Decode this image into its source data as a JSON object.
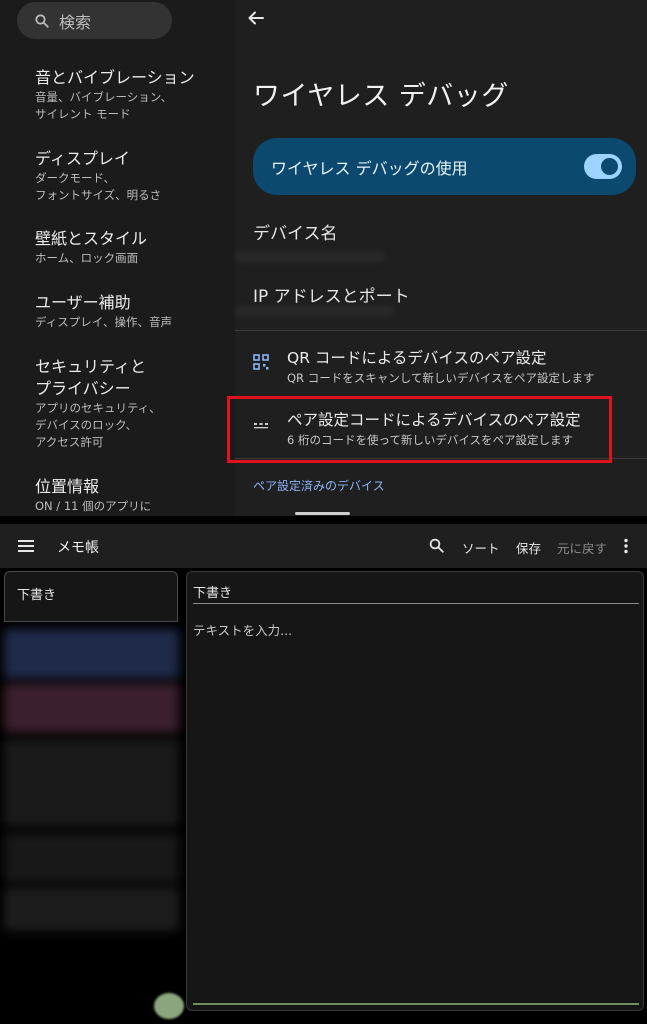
{
  "settings": {
    "search": {
      "placeholder": "検索"
    },
    "nav": [
      {
        "title": "音とバイブレーション",
        "sub": [
          "音量、バイブレーション、",
          "サイレント モード"
        ]
      },
      {
        "title": "ディスプレイ",
        "sub": [
          "ダークモード、",
          "フォントサイズ、明るさ"
        ]
      },
      {
        "title": "壁紙とスタイル",
        "sub": [
          "ホーム、ロック画面"
        ]
      },
      {
        "title": "ユーザー補助",
        "sub": [
          "ディスプレイ、操作、音声"
        ]
      },
      {
        "title": [
          "セキュリティと",
          "プライバシー"
        ],
        "sub": [
          "アプリのセキュリティ、",
          "デバイスのロック、",
          "アクセス許可"
        ]
      },
      {
        "title": "位置情報",
        "sub": [
          "ON / 11 個のアプリに"
        ]
      }
    ],
    "detail": {
      "title": "ワイヤレス デバッグ",
      "use_toggle": {
        "label": "ワイヤレス デバッグの使用",
        "enabled": true
      },
      "device_name_label": "デバイス名",
      "ip_label": "IP アドレスとポート",
      "pair_qr": {
        "title": "QR コードによるデバイスのペア設定",
        "sub": "QR コードをスキャンして新しいデバイスをペア設定します"
      },
      "pair_code": {
        "title": "ペア設定コードによるデバイスのペア設定",
        "sub": "6 桁のコードを使って新しいデバイスをペア設定します"
      },
      "paired_header": "ペア設定済みのデバイス"
    },
    "colors": {
      "accent": "#0b4a6e",
      "toggle_on": "#9dd3ff",
      "highlight_border": "#e0121c",
      "link": "#8ab4f8"
    }
  },
  "memo_app": {
    "title": "メモ帳",
    "toolbar": {
      "sort": "ソート",
      "save": "保存",
      "undo": "元に戻す"
    },
    "list": {
      "active_tab": "下書き"
    },
    "editor": {
      "title": "下書き",
      "placeholder": "テキストを入力..."
    },
    "colors": {
      "fab": "#8aa97a"
    }
  }
}
